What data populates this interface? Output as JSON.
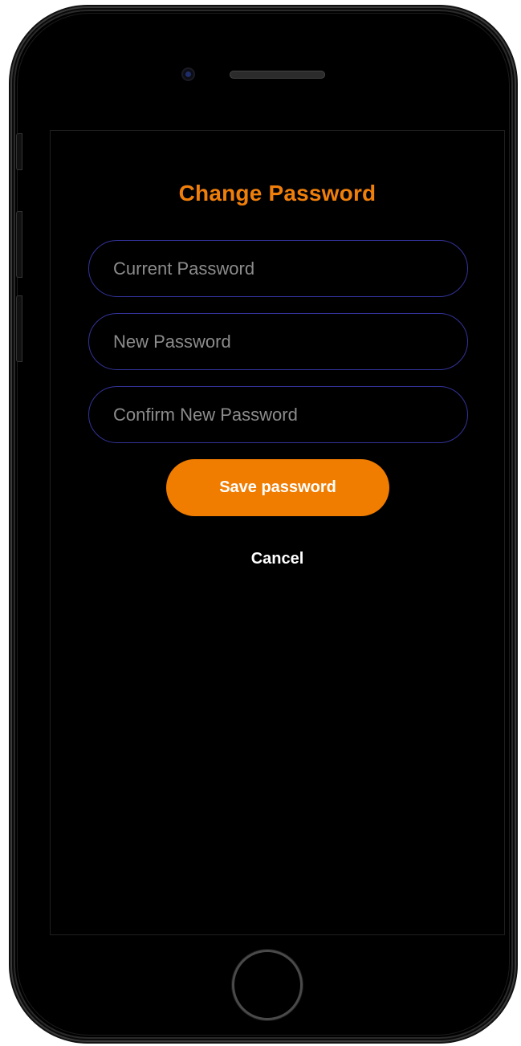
{
  "screen": {
    "title": "Change Password",
    "fields": [
      {
        "placeholder": "Current Password"
      },
      {
        "placeholder": "New Password"
      },
      {
        "placeholder": "Confirm New Password"
      }
    ],
    "save_label": "Save password",
    "cancel_label": "Cancel"
  },
  "colors": {
    "accent": "#f07c00",
    "title": "#ef7f0a",
    "field_border": "#33339a",
    "background": "#000000"
  }
}
